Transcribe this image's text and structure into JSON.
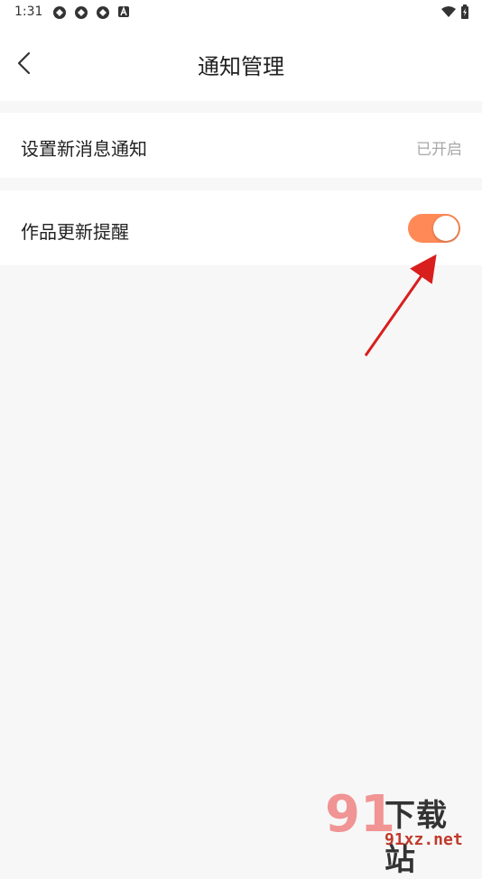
{
  "status_bar": {
    "time": "1:31"
  },
  "header": {
    "title": "通知管理"
  },
  "settings": {
    "new_message": {
      "label": "设置新消息通知",
      "value": "已开启"
    },
    "work_update": {
      "label": "作品更新提醒",
      "enabled": true
    }
  },
  "watermark": {
    "title": "下载站",
    "url": "91xz.net",
    "logo": "91"
  },
  "colors": {
    "accent": "#ff8a57",
    "background": "#f7f7f7",
    "arrow": "#d91e1e"
  }
}
